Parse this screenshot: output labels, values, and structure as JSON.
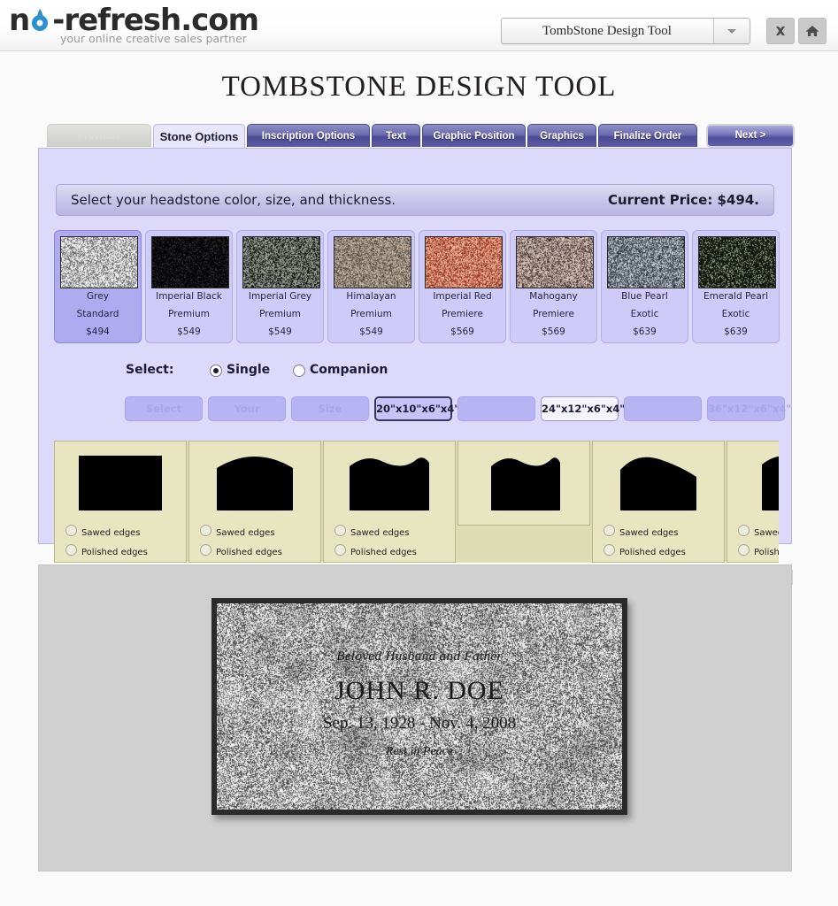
{
  "brand": {
    "logo_text_1": "n",
    "logo_text_2": "-refresh.com",
    "tagline": "your online creative sales partner"
  },
  "topbar": {
    "app_select_value": "TombStone Design Tool",
    "close_label": "Close",
    "home_label": "Home"
  },
  "page": {
    "title": "TOMBSTONE DESIGN TOOL"
  },
  "tabs": [
    {
      "label": "Previous",
      "state": "disabled"
    },
    {
      "label": "Stone Options",
      "state": "active"
    },
    {
      "label": "Inscription Options",
      "state": "normal"
    },
    {
      "label": "Text",
      "state": "normal"
    },
    {
      "label": "Graphic Position",
      "state": "normal"
    },
    {
      "label": "Graphics",
      "state": "normal"
    },
    {
      "label": "Finalize Order",
      "state": "normal"
    },
    {
      "label": "Next >",
      "state": "next"
    }
  ],
  "instruction": {
    "text": "Select your headstone color, size, and thickness.",
    "price_label": "Current Price: $494."
  },
  "stones": [
    {
      "name": "Grey",
      "grade": "Standard",
      "price": "$494",
      "selected": true,
      "color": "#b9b9b9"
    },
    {
      "name": "Imperial Black",
      "grade": "Premium",
      "price": "$549",
      "selected": false,
      "color": "#0b0b0c"
    },
    {
      "name": "Imperial Grey",
      "grade": "Premium",
      "price": "$549",
      "selected": false,
      "color": "#5b6058"
    },
    {
      "name": "Himalayan",
      "grade": "Premium",
      "price": "$549",
      "selected": false,
      "color": "#8e8277"
    },
    {
      "name": "Imperial Red",
      "grade": "Premiere",
      "price": "$569",
      "selected": false,
      "color": "#d2694f"
    },
    {
      "name": "Mahogany",
      "grade": "Premiere",
      "price": "$569",
      "selected": false,
      "color": "#9a7f79"
    },
    {
      "name": "Blue Pearl",
      "grade": "Exotic",
      "price": "$639",
      "selected": false,
      "color": "#66727a"
    },
    {
      "name": "Emerald Pearl",
      "grade": "Exotic",
      "price": "$639",
      "selected": false,
      "color": "#1d2117"
    }
  ],
  "select_row": {
    "label": "Select:",
    "options": [
      {
        "label": "Single",
        "checked": true
      },
      {
        "label": "Companion",
        "checked": false
      }
    ]
  },
  "sizes": [
    {
      "label": "Select",
      "style": "ghost"
    },
    {
      "label": "Your",
      "style": "ghost"
    },
    {
      "label": "Size",
      "style": "ghost"
    },
    {
      "label": "20\"x10\"x6\"x4\"",
      "style": "selected"
    },
    {
      "label": "",
      "style": "blank"
    },
    {
      "label": "24\"x12\"x6\"x4\"",
      "style": "plain"
    },
    {
      "label": "",
      "style": "blank"
    },
    {
      "label": "36\"x12\"x6\"x4\"",
      "style": "ghost"
    }
  ],
  "shapes": {
    "edge_option_1": "Sawed edges",
    "edge_option_2": "Polished edges",
    "items": [
      {
        "shape": "rectangle",
        "short": false
      },
      {
        "shape": "arched-top",
        "short": false
      },
      {
        "shape": "serpentine-top",
        "short": false
      },
      {
        "shape": "tapered-serpentine",
        "short": true
      },
      {
        "shape": "oval-crest",
        "short": false
      },
      {
        "shape": "peaked-partial",
        "short": false
      }
    ]
  },
  "scrollbar": {
    "left_arrow": "left-arrow",
    "right_arrow": "right-arrow"
  },
  "preview": {
    "epitaph_top": "Beloved Husband and Father",
    "name": "JOHN R. DOE",
    "dates": "Sep. 13, 1928 - Nov. 4, 2008",
    "epitaph_bottom": "Rest in Peace"
  },
  "colors": {
    "accent_purple": "#4b4a92",
    "panel_purple": "#dcd9fb",
    "shape_panel": "#e8e6c0",
    "preview_bg": "#d0d0d0"
  }
}
